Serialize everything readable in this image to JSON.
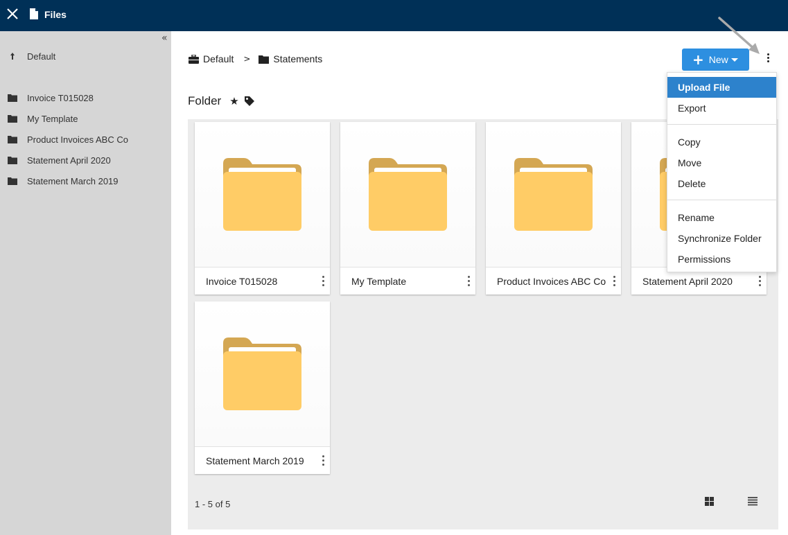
{
  "topbar": {
    "title": "Files"
  },
  "sidebar": {
    "collapse_glyph": "«",
    "parent": {
      "label": "Default",
      "icon": "up-arrow-icon"
    },
    "items": [
      {
        "label": "Invoice T015028"
      },
      {
        "label": "My Template"
      },
      {
        "label": "Product Invoices ABC Co"
      },
      {
        "label": "Statement April 2020"
      },
      {
        "label": "Statement March 2019"
      }
    ]
  },
  "breadcrumb": {
    "root": "Default",
    "separator": ">",
    "current": "Statements"
  },
  "new_button": {
    "label": "New"
  },
  "heading": {
    "title": "Folder",
    "star": "★"
  },
  "cards": [
    {
      "name": "Invoice T015028"
    },
    {
      "name": "My Template"
    },
    {
      "name": "Product Invoices ABC Co"
    },
    {
      "name": "Statement April 2020"
    },
    {
      "name": "Statement March 2019"
    }
  ],
  "pager": {
    "text": "1 - 5 of 5"
  },
  "menu": {
    "group1": [
      "Upload File",
      "Export"
    ],
    "group2": [
      "Copy",
      "Move",
      "Delete"
    ],
    "group3": [
      "Rename",
      "Synchronize Folder",
      "Permissions"
    ]
  },
  "colors": {
    "topbar": "#003057",
    "accent": "#2d8fe0",
    "menu_active": "#2d82cc",
    "folder_front": "#ffcc66",
    "folder_back": "#d4a753",
    "sidebar_bg": "#d6d6d6",
    "grid_bg": "#ececec"
  }
}
